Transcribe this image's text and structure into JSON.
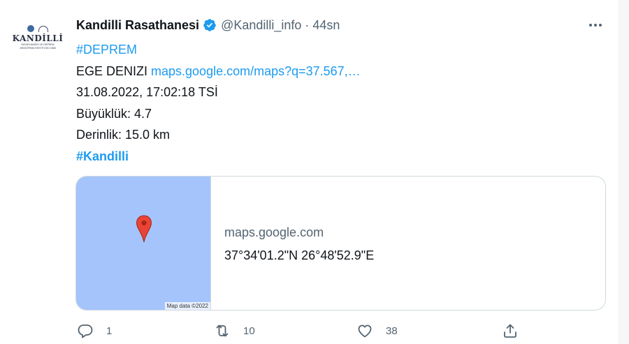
{
  "tweet": {
    "author": {
      "display_name": "Kandilli Rasathanesi",
      "handle": "@Kandilli_info",
      "verified": true,
      "avatar": {
        "logo_name": "KANDİLLİ",
        "logo_subtitle": "RASATHANESİ VE DEPREM ARAŞTIRMA ENSTİTÜSÜ 1868"
      }
    },
    "separator": "·",
    "time": "44sn",
    "more_icon": "more-horizontal-icon",
    "text": {
      "hashtag_deprem": "#DEPREM",
      "location": "EGE DENIZI ",
      "maps_link": "maps.google.com/maps?q=37.567,…",
      "datetime": "31.08.2022, 17:02:18 TSİ",
      "magnitude": "Büyüklük: 4.7",
      "depth": "Derinlik: 15.0 km",
      "hashtag_kandilli": "#Kandilli"
    },
    "card": {
      "map_credit": "Map data ©2022",
      "domain": "maps.google.com",
      "title": "37°34'01.2\"N 26°48'52.9\"E",
      "map_color": "#a4c4fb",
      "pin_color": "#ea4335"
    },
    "actions": {
      "reply": {
        "icon": "reply-icon",
        "count": "1"
      },
      "retweet": {
        "icon": "retweet-icon",
        "count": "10"
      },
      "like": {
        "icon": "heart-icon",
        "count": "38"
      },
      "share": {
        "icon": "share-icon"
      }
    }
  },
  "colors": {
    "link": "#1d9bf0",
    "text": "#0f1419",
    "secondary": "#536471",
    "border": "#cfd9de"
  }
}
